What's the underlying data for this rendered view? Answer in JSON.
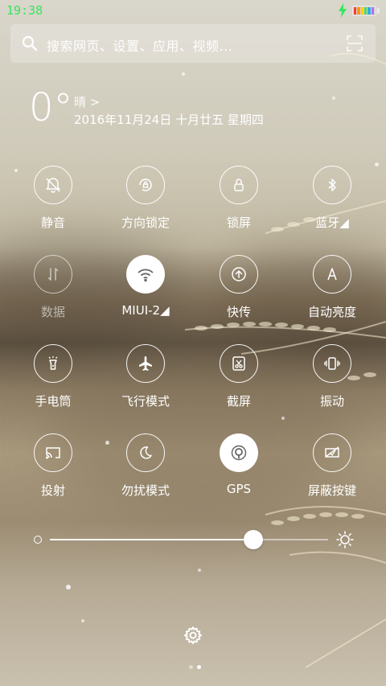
{
  "status_bar": {
    "time": "19:38",
    "battery_colors": [
      "#ff3b30",
      "#ff9500",
      "#ffcc00",
      "#4cd964",
      "#34aadc",
      "#b26cff"
    ]
  },
  "search": {
    "placeholder": "搜索网页、设置、应用、视频..."
  },
  "weather": {
    "temperature": "0°",
    "condition": "晴 >",
    "date": "2016年11月24日  十月廿五  星期四"
  },
  "toggles": [
    {
      "label": "静音",
      "icon": "bell-off-icon",
      "on": false,
      "dim": false
    },
    {
      "label": "方向锁定",
      "icon": "rotation-lock-icon",
      "on": false,
      "dim": false
    },
    {
      "label": "锁屏",
      "icon": "lock-icon",
      "on": false,
      "dim": false
    },
    {
      "label": "蓝牙◢",
      "icon": "bluetooth-icon",
      "on": false,
      "dim": false
    },
    {
      "label": "数据",
      "icon": "mobile-data-icon",
      "on": false,
      "dim": true
    },
    {
      "label": "MIUI-2◢",
      "icon": "wifi-icon",
      "on": true,
      "dim": false
    },
    {
      "label": "快传",
      "icon": "quick-transfer-icon",
      "on": false,
      "dim": false
    },
    {
      "label": "自动亮度",
      "icon": "auto-brightness-icon",
      "on": false,
      "dim": false
    },
    {
      "label": "手电筒",
      "icon": "flashlight-icon",
      "on": false,
      "dim": false
    },
    {
      "label": "飞行模式",
      "icon": "airplane-icon",
      "on": false,
      "dim": false
    },
    {
      "label": "截屏",
      "icon": "screenshot-icon",
      "on": false,
      "dim": false
    },
    {
      "label": "振动",
      "icon": "vibrate-icon",
      "on": false,
      "dim": false
    },
    {
      "label": "投射",
      "icon": "cast-icon",
      "on": false,
      "dim": false
    },
    {
      "label": "勿扰模式",
      "icon": "moon-icon",
      "on": false,
      "dim": false
    },
    {
      "label": "GPS",
      "icon": "gps-icon",
      "on": true,
      "dim": false
    },
    {
      "label": "屏蔽按键",
      "icon": "keys-blocked-icon",
      "on": false,
      "dim": false
    }
  ],
  "brightness": {
    "level": 0.73
  },
  "pager": {
    "count": 2,
    "active": 1
  }
}
